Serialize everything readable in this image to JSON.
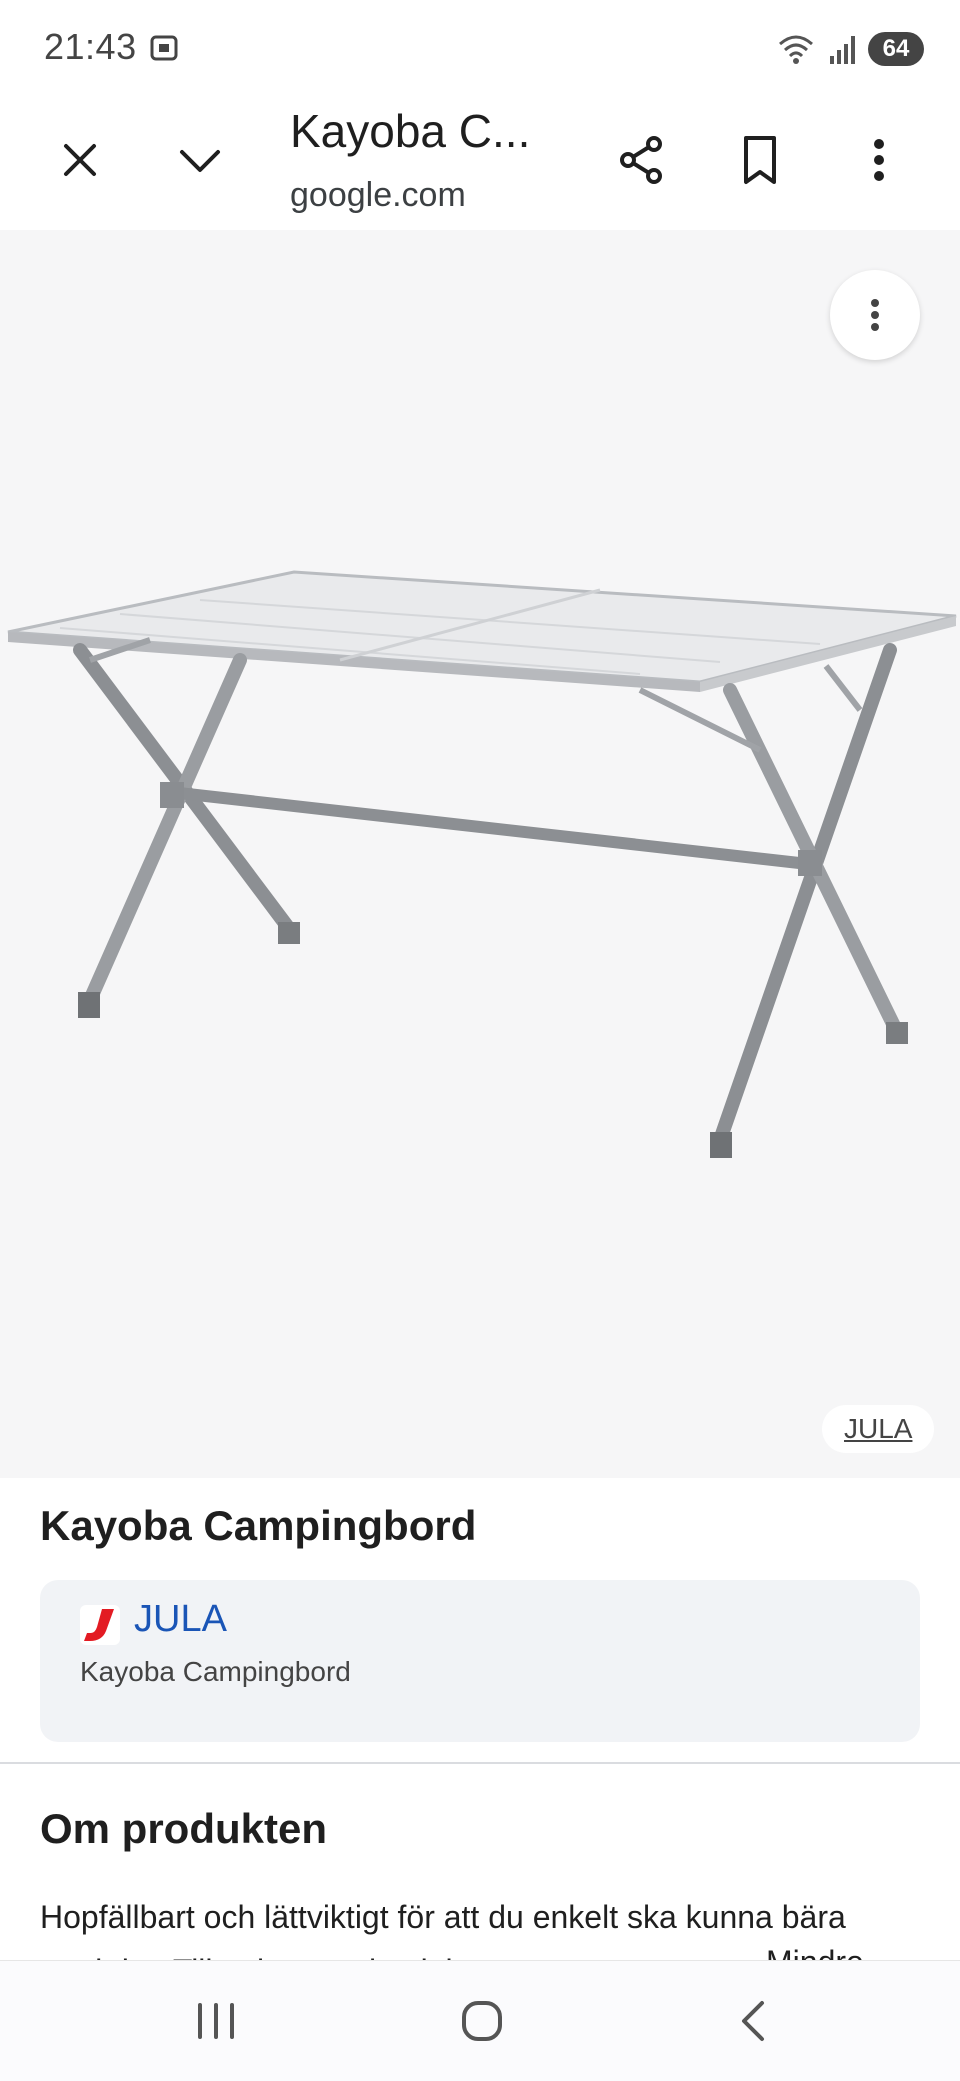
{
  "status_bar": {
    "time": "21:43",
    "battery": "64"
  },
  "toolbar": {
    "title": "Kayoba C...",
    "url": "google.com"
  },
  "image": {
    "source_chip": "JULA",
    "subject": "folding camping table"
  },
  "product": {
    "title": "Kayoba Campingbord",
    "store_name": "JULA",
    "store_subtitle": "Kayoba Campingbord"
  },
  "about": {
    "heading": "Om produkten",
    "description": "Hopfällbart och lättviktigt för att du enkelt ska kunna bära med det. Tillverkat av aluminium.",
    "less_label": "Mindre"
  },
  "colors": {
    "accent": "#1a55b6",
    "brand_red": "#e31b23"
  }
}
